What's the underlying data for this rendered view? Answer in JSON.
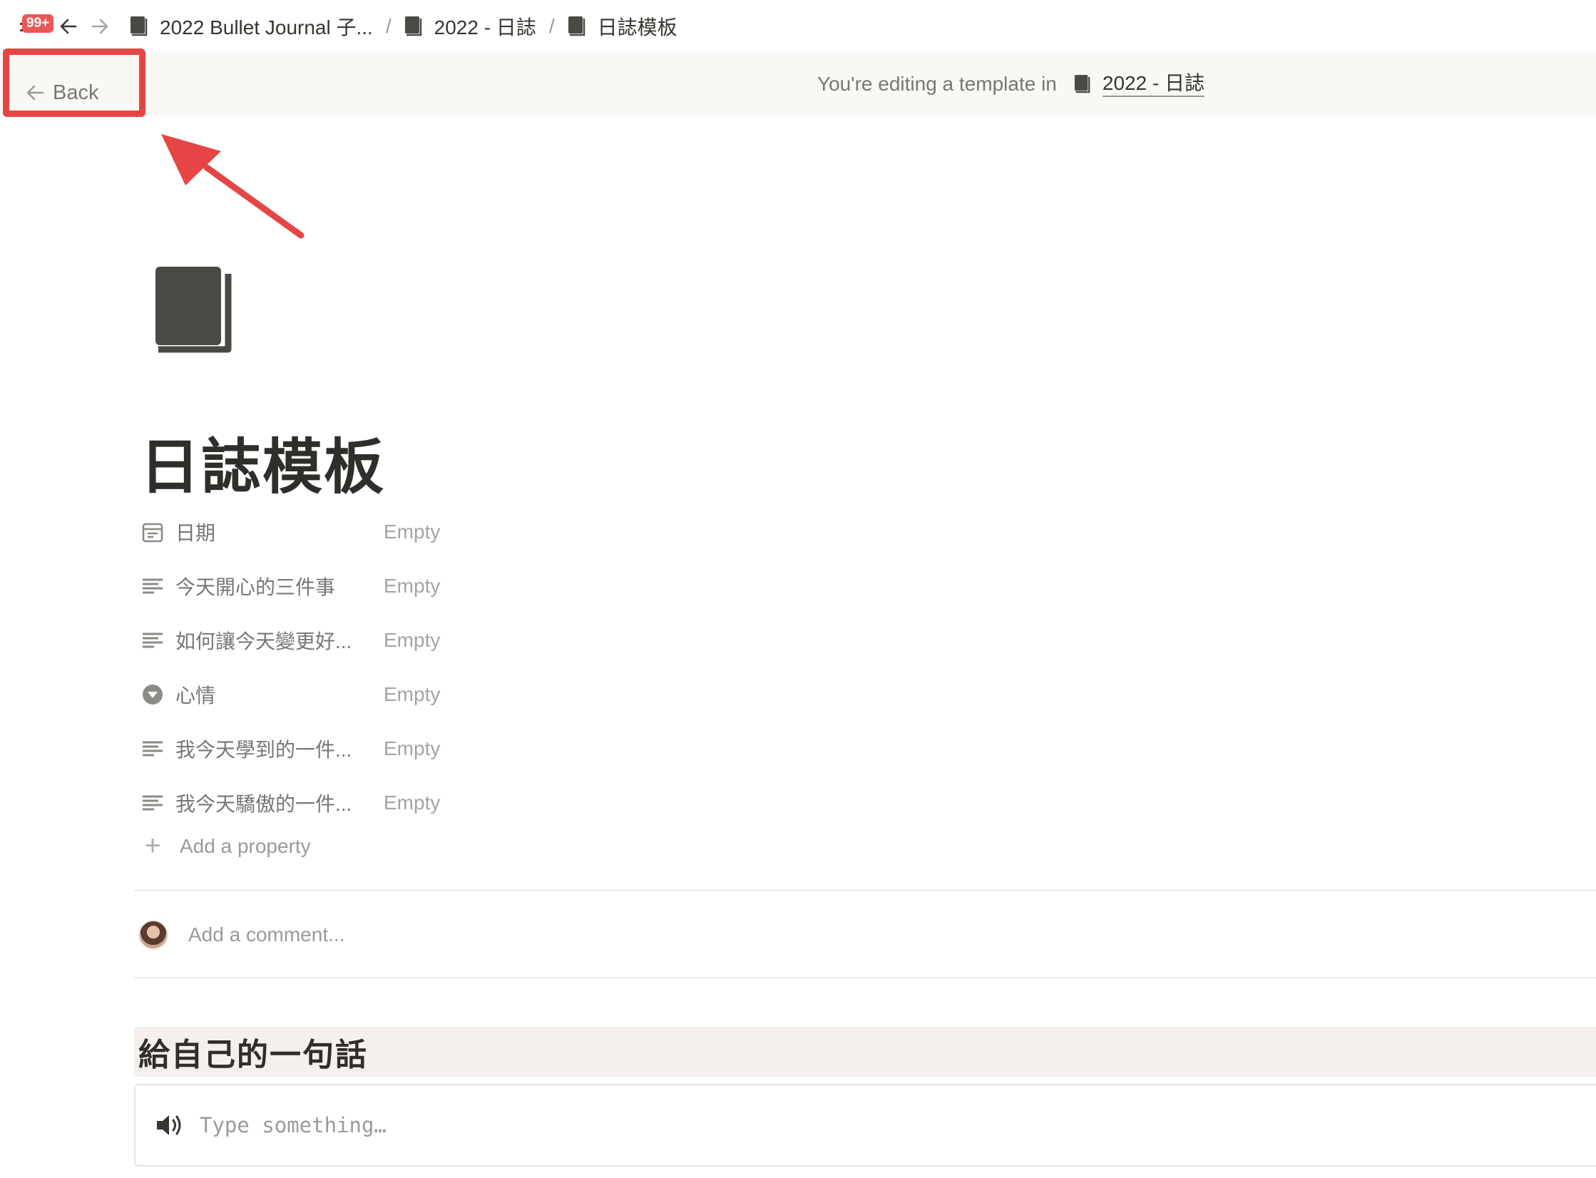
{
  "topbar": {
    "badge": "99+",
    "breadcrumbs": [
      {
        "label": "2022 Bullet Journal 子..."
      },
      {
        "label": "2022 - 日誌"
      },
      {
        "label": "日誌模板"
      }
    ],
    "separator": "/"
  },
  "banner": {
    "back_label": "Back",
    "editing_text": "You're editing a template in",
    "target_label": "2022 - 日誌"
  },
  "page": {
    "title": "日誌模板",
    "properties": [
      {
        "name": "日期",
        "value": "Empty",
        "icon": "calendar-icon"
      },
      {
        "name": "今天開心的三件事",
        "value": "Empty",
        "icon": "text-lines-icon"
      },
      {
        "name": "如何讓今天變更好...",
        "value": "Empty",
        "icon": "text-lines-icon"
      },
      {
        "name": "心情",
        "value": "Empty",
        "icon": "select-icon"
      },
      {
        "name": "我今天學到的一件...",
        "value": "Empty",
        "icon": "text-lines-icon"
      },
      {
        "name": "我今天驕傲的一件...",
        "value": "Empty",
        "icon": "text-lines-icon"
      }
    ],
    "add_property_label": "Add a property",
    "comment_placeholder": "Add a comment...",
    "heading": "給自己的一句話",
    "callout_placeholder": "Type something…"
  },
  "colors": {
    "accent_red": "#e64545",
    "banner_bg": "#f9f8f4",
    "heading_bg": "#f5efee",
    "badge_red": "#eb5757"
  }
}
